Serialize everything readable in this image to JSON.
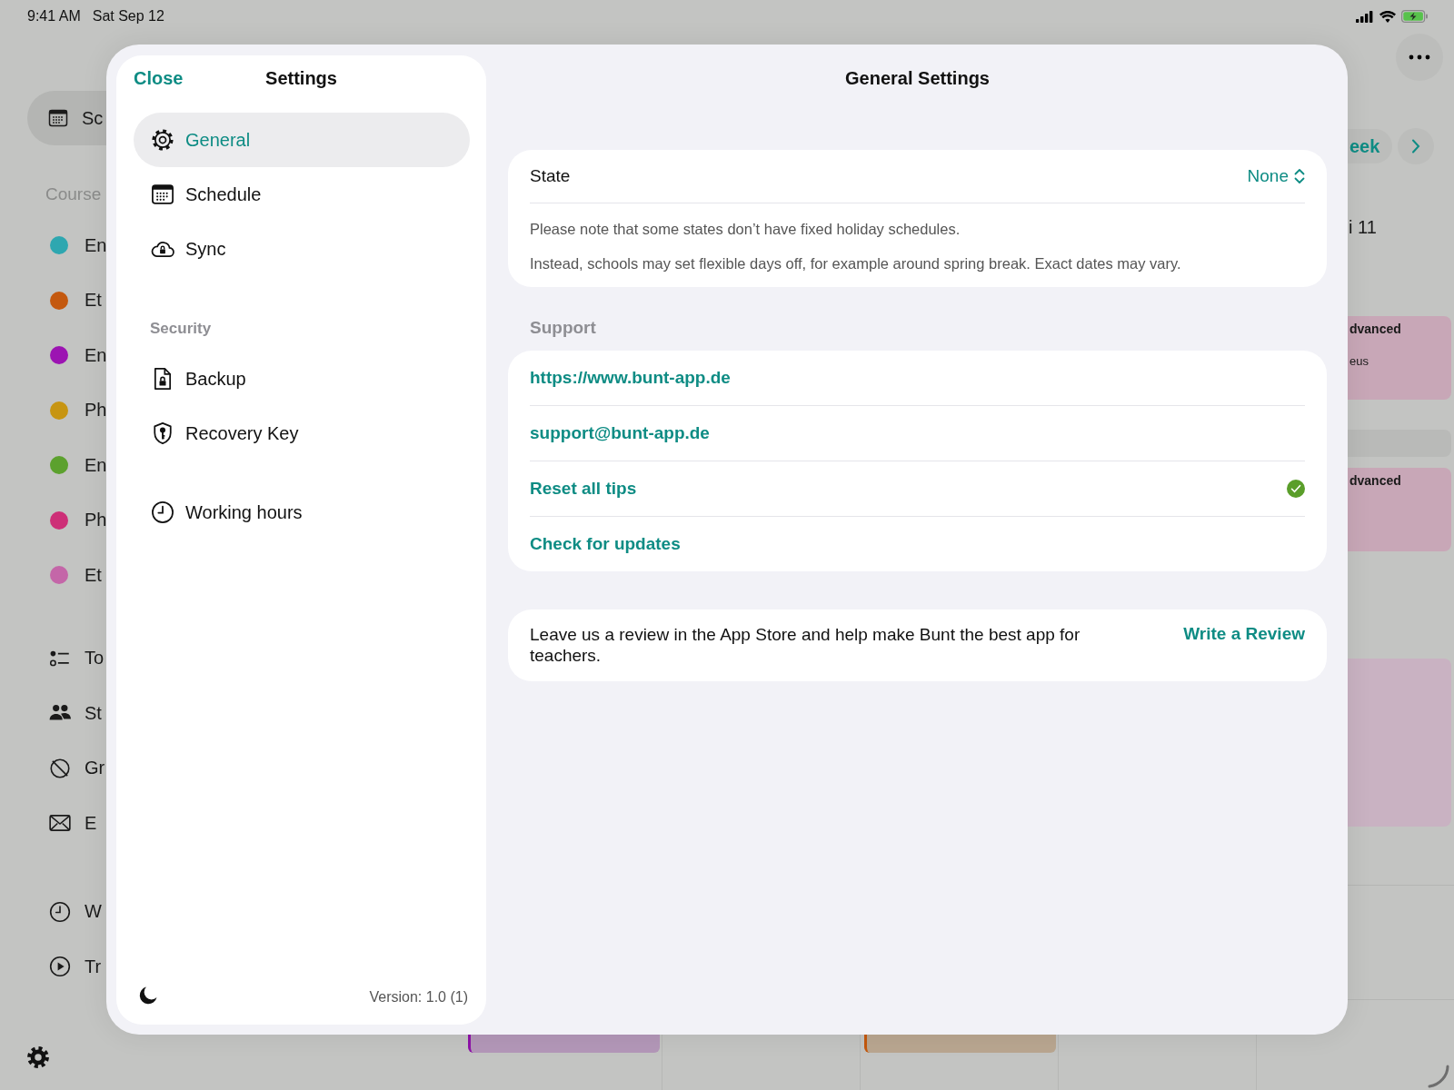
{
  "status_bar": {
    "time": "9:41 AM",
    "date": "Sat Sep 12"
  },
  "app_sidebar": {
    "current": {
      "label": "Sc",
      "selected": true
    },
    "section": "Course",
    "courses": [
      {
        "label": "En",
        "color": "#2ea7b0"
      },
      {
        "label": "Et",
        "color": "#c4590f"
      },
      {
        "label": "En",
        "color": "#9c14b2"
      },
      {
        "label": "Ph",
        "color": "#c79512"
      },
      {
        "label": "En",
        "color": "#5ca12e"
      },
      {
        "label": "Ph",
        "color": "#cd2f77"
      },
      {
        "label": "Et",
        "color": "#c466a8"
      }
    ],
    "tools": [
      {
        "label": "To"
      },
      {
        "label": "St"
      },
      {
        "label": "Gr"
      },
      {
        "label": "E"
      }
    ],
    "extras": [
      {
        "label": "W"
      },
      {
        "label": "Tr"
      }
    ]
  },
  "calendar": {
    "view_button": "eek",
    "day": "i 11",
    "events": [
      {
        "title": "dvanced",
        "detail": "eus",
        "color": "#c8a7b7"
      },
      {
        "color": "#b9bab8"
      },
      {
        "title": "dvanced",
        "color": "#c8a7b7"
      },
      {
        "color": "#c9b2c2"
      }
    ],
    "bottom_events": [
      {
        "color": "#b397b8"
      },
      {
        "color": "#b9a690"
      }
    ]
  },
  "settings": {
    "close": "Close",
    "title": "Settings",
    "nav": [
      {
        "items": [
          {
            "label": "General",
            "selected": true
          },
          {
            "label": "Schedule",
            "selected": false
          },
          {
            "label": "Sync",
            "selected": false
          }
        ]
      },
      {
        "header": "Security",
        "items": [
          {
            "label": "Backup",
            "selected": false
          },
          {
            "label": "Recovery Key",
            "selected": false
          }
        ]
      },
      {
        "items": [
          {
            "label": "Working hours",
            "selected": false
          }
        ]
      }
    ],
    "version": "Version: 1.0 (1)"
  },
  "general": {
    "title": "General Settings",
    "state": {
      "label": "State",
      "value": "None",
      "notes": [
        "Please note that some states don’t have fixed holiday schedules.",
        "Instead, schools may set flexible days off, for example around spring break. Exact dates may vary."
      ]
    },
    "support": {
      "header": "Support",
      "rows": [
        {
          "label": "https://www.bunt-app.de",
          "done": false
        },
        {
          "label": "support@bunt-app.de",
          "done": false
        },
        {
          "label": "Reset all tips",
          "done": true
        },
        {
          "label": "Check for updates",
          "done": false
        }
      ]
    },
    "review": {
      "text": "Leave us a review in the App Store and help make Bunt the best app for teachers.",
      "action": "Write a Review"
    }
  }
}
